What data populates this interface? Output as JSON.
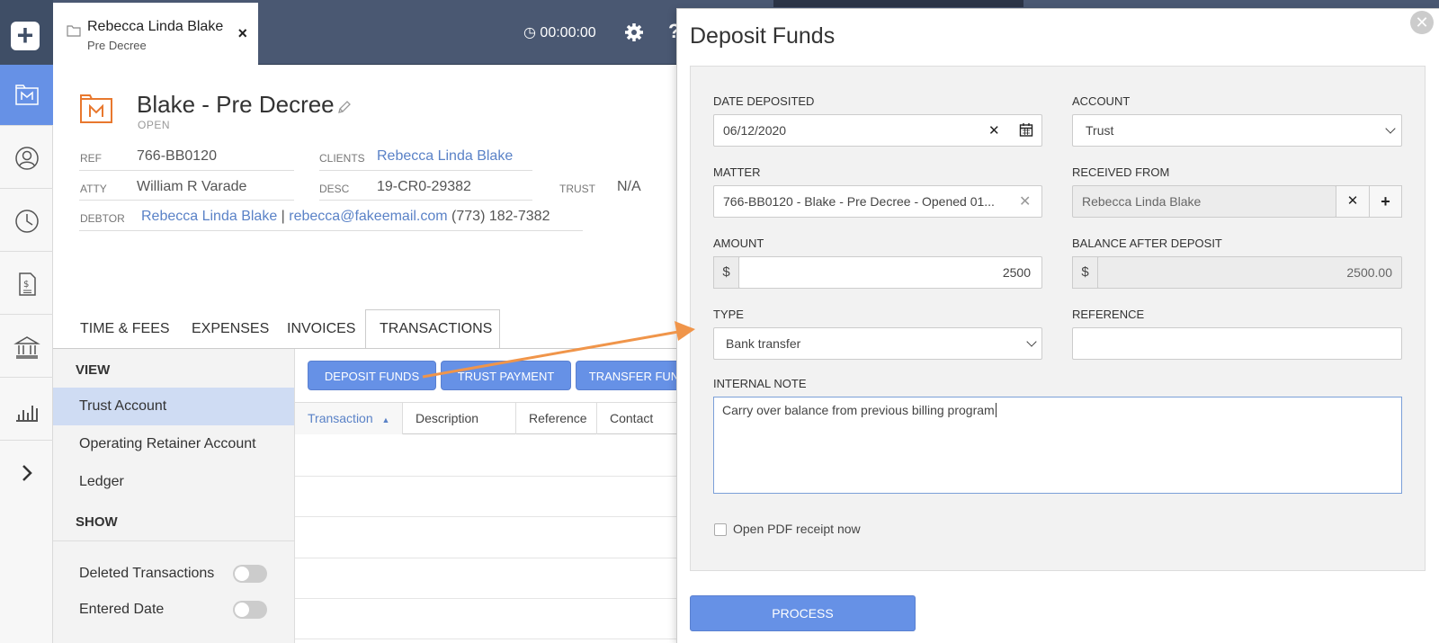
{
  "topbar": {
    "case_tab": {
      "name": "Rebecca Linda Blake",
      "subtitle": "Pre Decree",
      "close_glyph": "×"
    },
    "timer": "00:00:00",
    "help_glyph": "?"
  },
  "rail": {
    "items": [
      {
        "icon": "plus-icon"
      },
      {
        "icon": "matter-icon",
        "active": true
      },
      {
        "icon": "contact-icon"
      },
      {
        "icon": "clock-icon"
      },
      {
        "icon": "invoice-icon"
      },
      {
        "icon": "bank-icon"
      },
      {
        "icon": "reports-icon"
      },
      {
        "icon": "chevron-right-icon"
      }
    ]
  },
  "matter": {
    "title": "Blake - Pre Decree",
    "status": "OPEN",
    "ref_label": "REF",
    "ref": "766-BB0120",
    "clients_label": "CLIENTS",
    "clients": "Rebecca Linda Blake",
    "atty_label": "ATTY",
    "atty": "William R Varade",
    "desc_label": "DESC",
    "desc": "19-CR0-29382",
    "trust_label": "TRUST",
    "trust": "N/A",
    "debtor_label": "DEBTOR",
    "debtor_name": "Rebecca Linda Blake",
    "debtor_sep": "|",
    "debtor_email": "rebecca@fakeemail.com",
    "debtor_phone": "(773) 182-7382"
  },
  "tabs": [
    "TIME & FEES",
    "EXPENSES",
    "INVOICES",
    "TRANSACTIONS"
  ],
  "view_panel": {
    "view_heading": "VIEW",
    "views": [
      "Trust Account",
      "Operating Retainer Account",
      "Ledger"
    ],
    "show_heading": "SHOW",
    "toggles": [
      "Deleted Transactions",
      "Entered Date"
    ]
  },
  "actions": [
    "DEPOSIT FUNDS",
    "TRUST PAYMENT",
    "TRANSFER FUN"
  ],
  "grid": {
    "columns": [
      "Transaction",
      "Description",
      "Reference",
      "Contact"
    ],
    "sort_glyph": "▲"
  },
  "modal": {
    "title": "Deposit Funds",
    "close_glyph": "✕",
    "date_label": "DATE DEPOSITED",
    "date": "06/12/2020",
    "account_label": "ACCOUNT",
    "account": "Trust",
    "matter_label": "MATTER",
    "matter": "766-BB0120 - Blake - Pre Decree - Opened 01...",
    "received_label": "RECEIVED FROM",
    "received": "Rebecca Linda Blake",
    "amount_label": "AMOUNT",
    "currency": "$",
    "amount": "2500",
    "balance_label": "BALANCE AFTER DEPOSIT",
    "balance": "2500.00",
    "type_label": "TYPE",
    "type": "Bank transfer",
    "reference_label": "REFERENCE",
    "reference": "",
    "note_label": "INTERNAL NOTE",
    "note": "Carry over balance from previous billing program",
    "pdf_label": "Open PDF receipt now",
    "process_label": "PROCESS"
  },
  "colors": {
    "accent": "#6691e6",
    "topbar": "#4a5872",
    "link": "#5a82c7",
    "arrow": "#f0954a",
    "matter_icon": "#e8782e"
  }
}
